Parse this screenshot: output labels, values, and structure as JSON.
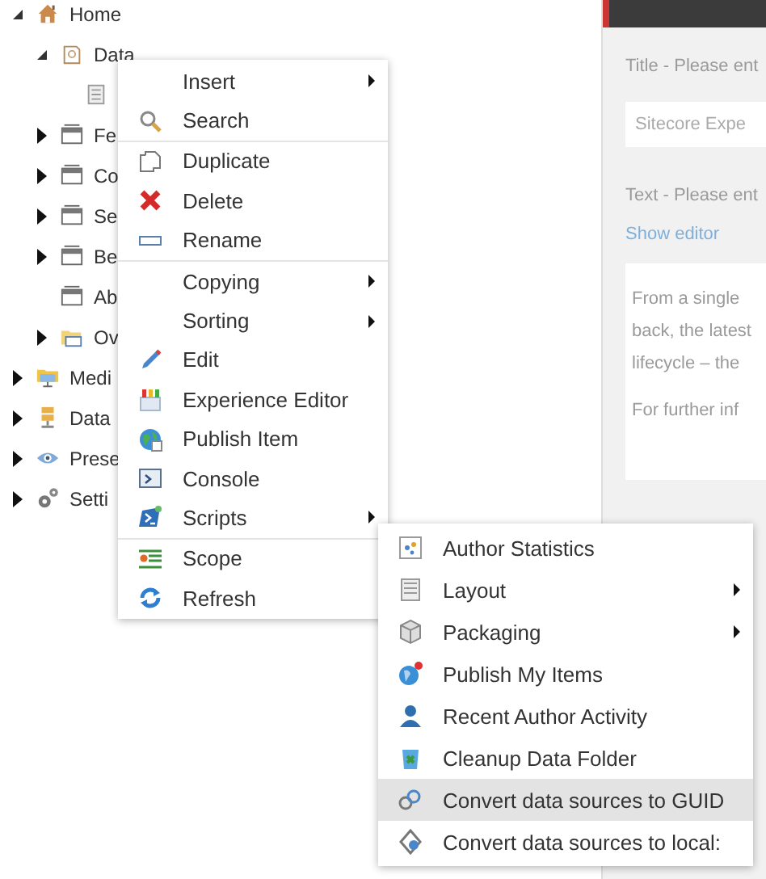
{
  "tree": [
    {
      "label": "Home",
      "expanded": true,
      "children": [
        {
          "label": "Data",
          "expanded": true,
          "children": [
            {
              "kind": "item"
            }
          ]
        },
        {
          "label": "Fe",
          "expanded": false
        },
        {
          "label": "Co",
          "expanded": false
        },
        {
          "label": "Se",
          "expanded": false
        },
        {
          "label": "Be",
          "expanded": false
        },
        {
          "label": "Ab"
        },
        {
          "label": "Ov",
          "expanded": false
        }
      ]
    },
    {
      "label": "Medi",
      "expanded": false
    },
    {
      "label": "Data",
      "expanded": false
    },
    {
      "label": "Prese",
      "expanded": false
    },
    {
      "label": "Setti",
      "expanded": false
    }
  ],
  "editor": {
    "title_label": "Title - Please ent",
    "title_value": "Sitecore Expe",
    "text_label": "Text - Please ent",
    "show_editor": "Show editor",
    "text_lines": [
      "From a single",
      "back, the latest",
      "lifecycle – the"
    ],
    "text_note": "For further inf"
  },
  "context_menu": {
    "groups": [
      [
        {
          "label": "Insert",
          "submenu": true
        },
        {
          "label": "Search",
          "submenu": false
        }
      ],
      [
        {
          "label": "Duplicate",
          "submenu": false
        },
        {
          "label": "Delete",
          "submenu": false
        },
        {
          "label": "Rename",
          "submenu": false
        }
      ],
      [
        {
          "label": "Copying",
          "submenu": true
        },
        {
          "label": "Sorting",
          "submenu": true
        },
        {
          "label": "Edit",
          "submenu": false
        },
        {
          "label": "Experience Editor",
          "submenu": false
        },
        {
          "label": "Publish Item",
          "submenu": false
        },
        {
          "label": "Console",
          "submenu": false
        },
        {
          "label": "Scripts",
          "submenu": true
        }
      ],
      [
        {
          "label": "Scope",
          "submenu": false
        },
        {
          "label": "Refresh",
          "submenu": false
        }
      ]
    ]
  },
  "scripts_menu": {
    "items": [
      {
        "label": "Author Statistics",
        "submenu": false,
        "selected": false
      },
      {
        "label": "Layout",
        "submenu": true,
        "selected": false
      },
      {
        "label": "Packaging",
        "submenu": true,
        "selected": false
      },
      {
        "label": "Publish My Items",
        "submenu": false,
        "selected": false
      },
      {
        "label": "Recent Author Activity",
        "submenu": false,
        "selected": false
      },
      {
        "label": "Cleanup Data Folder",
        "submenu": false,
        "selected": false
      },
      {
        "label": "Convert data sources to GUID",
        "submenu": false,
        "selected": true
      },
      {
        "label": "Convert data sources to local:",
        "submenu": false,
        "selected": false
      }
    ]
  }
}
